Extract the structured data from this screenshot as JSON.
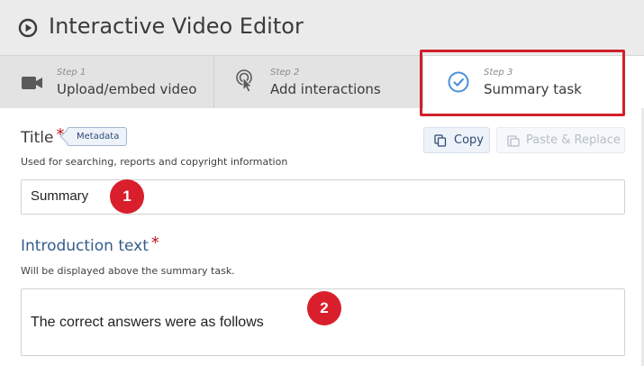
{
  "app": {
    "title": "Interactive Video Editor",
    "icon": "play-circle-icon"
  },
  "tabs": [
    {
      "step": "Step 1",
      "label": "Upload/embed video",
      "icon": "video-camera-icon",
      "active": false
    },
    {
      "step": "Step 2",
      "label": "Add interactions",
      "icon": "touch-pointer-icon",
      "active": false
    },
    {
      "step": "Step 3",
      "label": "Summary task",
      "icon": "checkmark-circle-icon",
      "active": true
    }
  ],
  "title_field": {
    "label": "Title",
    "required_mark": "*",
    "metadata_tag": "Metadata",
    "description": "Used for searching, reports and copyright information",
    "value": "Summary"
  },
  "toolbar": {
    "copy_label": "Copy",
    "paste_label": "Paste & Replace"
  },
  "intro_field": {
    "label": "Introduction text",
    "required_mark": "*",
    "description": "Will be displayed above the summary task.",
    "value": "The correct answers were as follows"
  },
  "markers": [
    "1",
    "2"
  ],
  "colors": {
    "header_bg": "#ebebeb",
    "tab_bg": "#e3e3e3",
    "active_tab_bg": "#ffffff",
    "highlight": "#d1202a",
    "marker": "#d91f2b",
    "required": "#c0141c",
    "accent_blue": "#355d8a",
    "check_blue": "#4a90d9"
  }
}
